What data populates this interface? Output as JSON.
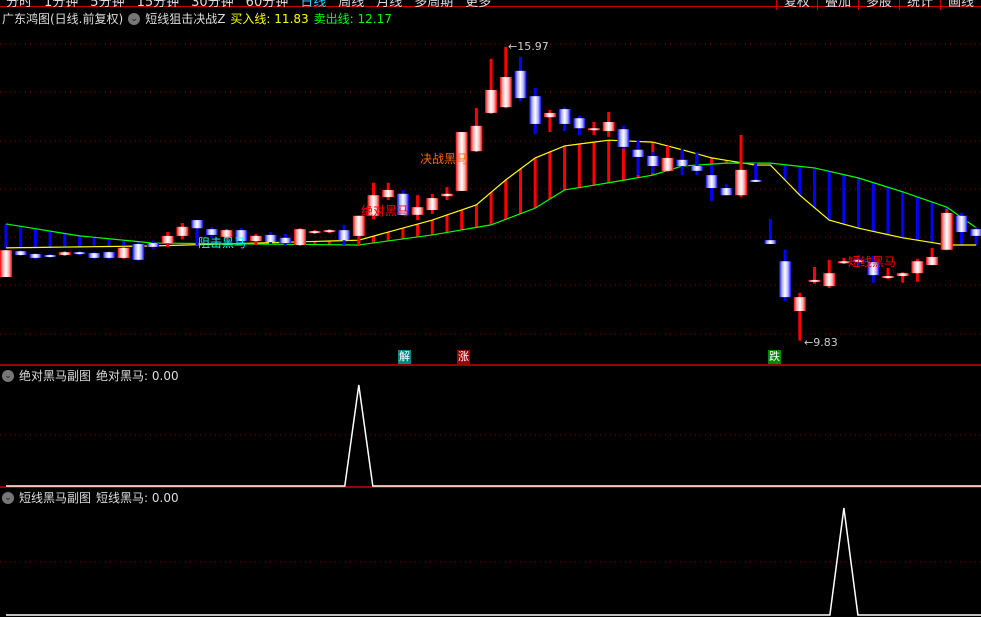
{
  "menu": {
    "left": [
      "分时",
      "1分钟",
      "5分钟",
      "15分钟",
      "30分钟",
      "60分钟",
      "日线",
      "周线",
      "月线",
      "多周期",
      "更多"
    ],
    "active_index": 6,
    "right": [
      "复权",
      "叠加",
      "多股",
      "统计",
      "画线"
    ]
  },
  "header": {
    "stock": "广东鸿图(日线.前复权)",
    "indicator": "短线狙击决战Z",
    "buy_label": "买入线:",
    "buy_value": "11.83",
    "sell_label": "卖出线:",
    "sell_value": "12.17"
  },
  "colors": {
    "up": "#ff0000",
    "down": "#0000ff",
    "buy_line": "#ffff00",
    "sell_line": "#00ff00",
    "grid": "#8b0000"
  },
  "markers": {
    "m1": "阻击黑马",
    "m2": "绝对黑马",
    "m3": "决战黑马",
    "m4": "短线黑马",
    "high": "15.97",
    "low": "9.83",
    "arrow": "←",
    "tag_jie": "解",
    "tag_zhang": "涨",
    "tag_die": "跌"
  },
  "sub1": {
    "title": "绝对黑马副图",
    "label": "绝对黑马:",
    "value": "0.00",
    "spike_index": 24
  },
  "sub2": {
    "title": "短线黑马副图",
    "label": "短线黑马:",
    "value": "0.00",
    "spike_index": 57
  },
  "chart_data": {
    "type": "candlestick",
    "price_range": [
      9.83,
      15.97
    ],
    "candles": [
      [
        11.16,
        11.72,
        11.72,
        11.16
      ],
      [
        11.7,
        11.62,
        11.72,
        11.6
      ],
      [
        11.64,
        11.56,
        11.66,
        11.54
      ],
      [
        11.62,
        11.58,
        11.64,
        11.56
      ],
      [
        11.62,
        11.68,
        11.7,
        11.6
      ],
      [
        11.68,
        11.64,
        11.7,
        11.62
      ],
      [
        11.66,
        11.56,
        11.68,
        11.54
      ],
      [
        11.68,
        11.56,
        11.7,
        11.54
      ],
      [
        11.56,
        11.77,
        11.79,
        11.54
      ],
      [
        11.85,
        11.52,
        11.87,
        11.5
      ],
      [
        11.87,
        11.79,
        11.92,
        11.75
      ],
      [
        11.87,
        12.02,
        12.1,
        11.79
      ],
      [
        12.02,
        12.21,
        12.29,
        11.95
      ],
      [
        12.35,
        12.18,
        12.35,
        11.83
      ],
      [
        12.16,
        12.04,
        12.2,
        11.98
      ],
      [
        12.0,
        12.14,
        12.16,
        11.96
      ],
      [
        12.14,
        11.91,
        12.18,
        11.87
      ],
      [
        11.91,
        12.02,
        12.06,
        11.83
      ],
      [
        12.04,
        11.89,
        12.1,
        11.85
      ],
      [
        11.98,
        11.87,
        12.06,
        11.81
      ],
      [
        11.83,
        12.16,
        12.18,
        11.81
      ],
      [
        12.08,
        12.12,
        12.14,
        12.06
      ],
      [
        12.1,
        12.14,
        12.16,
        12.08
      ],
      [
        12.14,
        11.93,
        12.25,
        11.83
      ],
      [
        12.02,
        12.44,
        12.44,
        11.83
      ],
      [
        12.44,
        12.87,
        13.13,
        12.37
      ],
      [
        12.83,
        12.98,
        13.13,
        12.77
      ],
      [
        12.9,
        12.46,
        12.98,
        12.44
      ],
      [
        12.46,
        12.62,
        12.87,
        12.35
      ],
      [
        12.56,
        12.81,
        12.9,
        12.48
      ],
      [
        12.85,
        12.9,
        13.04,
        12.77
      ],
      [
        12.96,
        14.19,
        14.19,
        12.96
      ],
      [
        13.79,
        14.32,
        14.69,
        13.77
      ],
      [
        14.59,
        15.07,
        15.72,
        14.57
      ],
      [
        14.71,
        15.34,
        15.97,
        14.69
      ],
      [
        15.47,
        14.9,
        15.76,
        14.84
      ],
      [
        14.94,
        14.36,
        15.11,
        14.15
      ],
      [
        14.5,
        14.59,
        14.65,
        14.19
      ],
      [
        14.67,
        14.36,
        14.71,
        14.21
      ],
      [
        14.48,
        14.27,
        14.53,
        14.13
      ],
      [
        14.25,
        14.27,
        14.4,
        14.13
      ],
      [
        14.21,
        14.4,
        14.61,
        14.09
      ],
      [
        14.25,
        13.88,
        14.32,
        13.84
      ],
      [
        13.82,
        13.67,
        14.02,
        13.29
      ],
      [
        13.69,
        13.48,
        13.77,
        13.33
      ],
      [
        13.38,
        13.65,
        13.9,
        13.36
      ],
      [
        13.61,
        13.48,
        13.84,
        13.29
      ],
      [
        13.48,
        13.38,
        13.77,
        13.29
      ],
      [
        13.29,
        13.02,
        13.5,
        12.75
      ],
      [
        13.02,
        12.87,
        13.1,
        12.87
      ],
      [
        12.87,
        13.4,
        14.13,
        12.83
      ],
      [
        13.19,
        13.15,
        13.54,
        13.15
      ],
      [
        11.93,
        11.85,
        12.37,
        11.85
      ],
      [
        11.49,
        10.74,
        11.73,
        10.66
      ],
      [
        10.45,
        10.74,
        10.83,
        9.83
      ],
      [
        11.08,
        11.1,
        11.37,
        11.02
      ],
      [
        10.97,
        11.24,
        11.52,
        10.93
      ],
      [
        11.47,
        11.49,
        11.56,
        11.43
      ],
      [
        11.52,
        11.47,
        11.62,
        11.35
      ],
      [
        11.47,
        11.2,
        11.6,
        11.04
      ],
      [
        11.16,
        11.18,
        11.35,
        11.12
      ],
      [
        11.18,
        11.24,
        11.26,
        11.04
      ],
      [
        11.24,
        11.49,
        11.54,
        11.06
      ],
      [
        11.41,
        11.58,
        11.77,
        11.41
      ],
      [
        11.73,
        12.5,
        12.58,
        11.72
      ],
      [
        12.44,
        12.1,
        12.5,
        11.89
      ],
      [
        12.16,
        12.02,
        12.2,
        11.95
      ]
    ],
    "buy_line_keypoints": [
      [
        0,
        11.77
      ],
      [
        10,
        11.81
      ],
      [
        24,
        11.93
      ],
      [
        26,
        12.1
      ],
      [
        29,
        12.35
      ],
      [
        32,
        12.67
      ],
      [
        34,
        13.19
      ],
      [
        36,
        13.65
      ],
      [
        38,
        13.9
      ],
      [
        41,
        14.02
      ],
      [
        44,
        13.98
      ],
      [
        46,
        13.82
      ],
      [
        48,
        13.65
      ],
      [
        51,
        13.5
      ],
      [
        52,
        13.5
      ],
      [
        54,
        12.87
      ],
      [
        56,
        12.35
      ],
      [
        58,
        12.18
      ],
      [
        61,
        11.98
      ],
      [
        64,
        11.83
      ],
      [
        66,
        11.83
      ]
    ],
    "sell_line_keypoints": [
      [
        0,
        12.27
      ],
      [
        5,
        12.02
      ],
      [
        10,
        11.87
      ],
      [
        24,
        11.83
      ],
      [
        29,
        12.04
      ],
      [
        33,
        12.25
      ],
      [
        36,
        12.6
      ],
      [
        38,
        12.98
      ],
      [
        41,
        13.13
      ],
      [
        44,
        13.29
      ],
      [
        46,
        13.48
      ],
      [
        49,
        13.54
      ],
      [
        52,
        13.54
      ],
      [
        55,
        13.44
      ],
      [
        58,
        13.23
      ],
      [
        61,
        12.94
      ],
      [
        64,
        12.62
      ],
      [
        66,
        12.19
      ]
    ]
  }
}
